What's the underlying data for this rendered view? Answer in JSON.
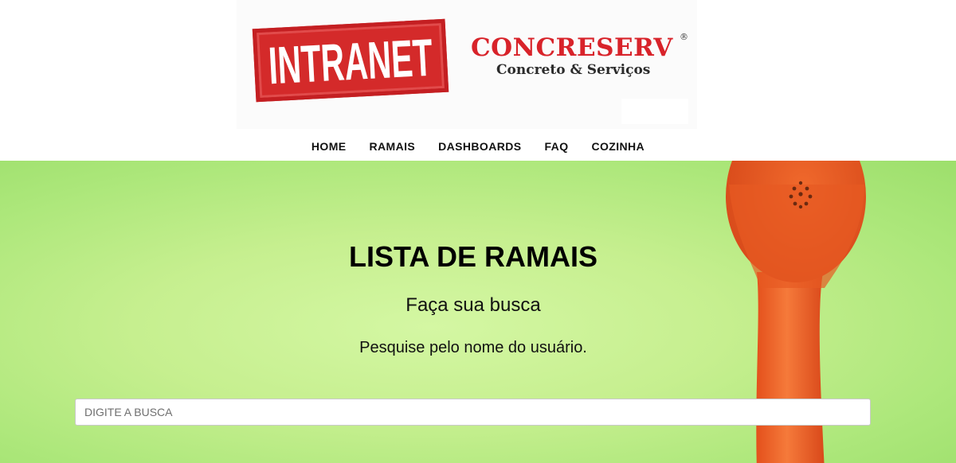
{
  "banner": {
    "intranet_text": "INTRANET",
    "brand_name": "CONCRESERV",
    "brand_reg": "®",
    "brand_subtitle": "Concreto & Serviços"
  },
  "nav": {
    "items": [
      {
        "label": "HOME"
      },
      {
        "label": "RAMAIS"
      },
      {
        "label": "DASHBOARDS"
      },
      {
        "label": "FAQ"
      },
      {
        "label": "COZINHA"
      }
    ]
  },
  "main": {
    "title": "LISTA DE RAMAIS",
    "subtitle": "Faça sua busca",
    "hint": "Pesquise pelo nome do usuário."
  },
  "search": {
    "placeholder": "DIGITE A BUSCA",
    "value": ""
  },
  "colors": {
    "stamp_red": "#d42a2a",
    "brand_red": "#d8232a",
    "hero_green": "#c6ef8f",
    "phone_orange": "#f2622a"
  }
}
